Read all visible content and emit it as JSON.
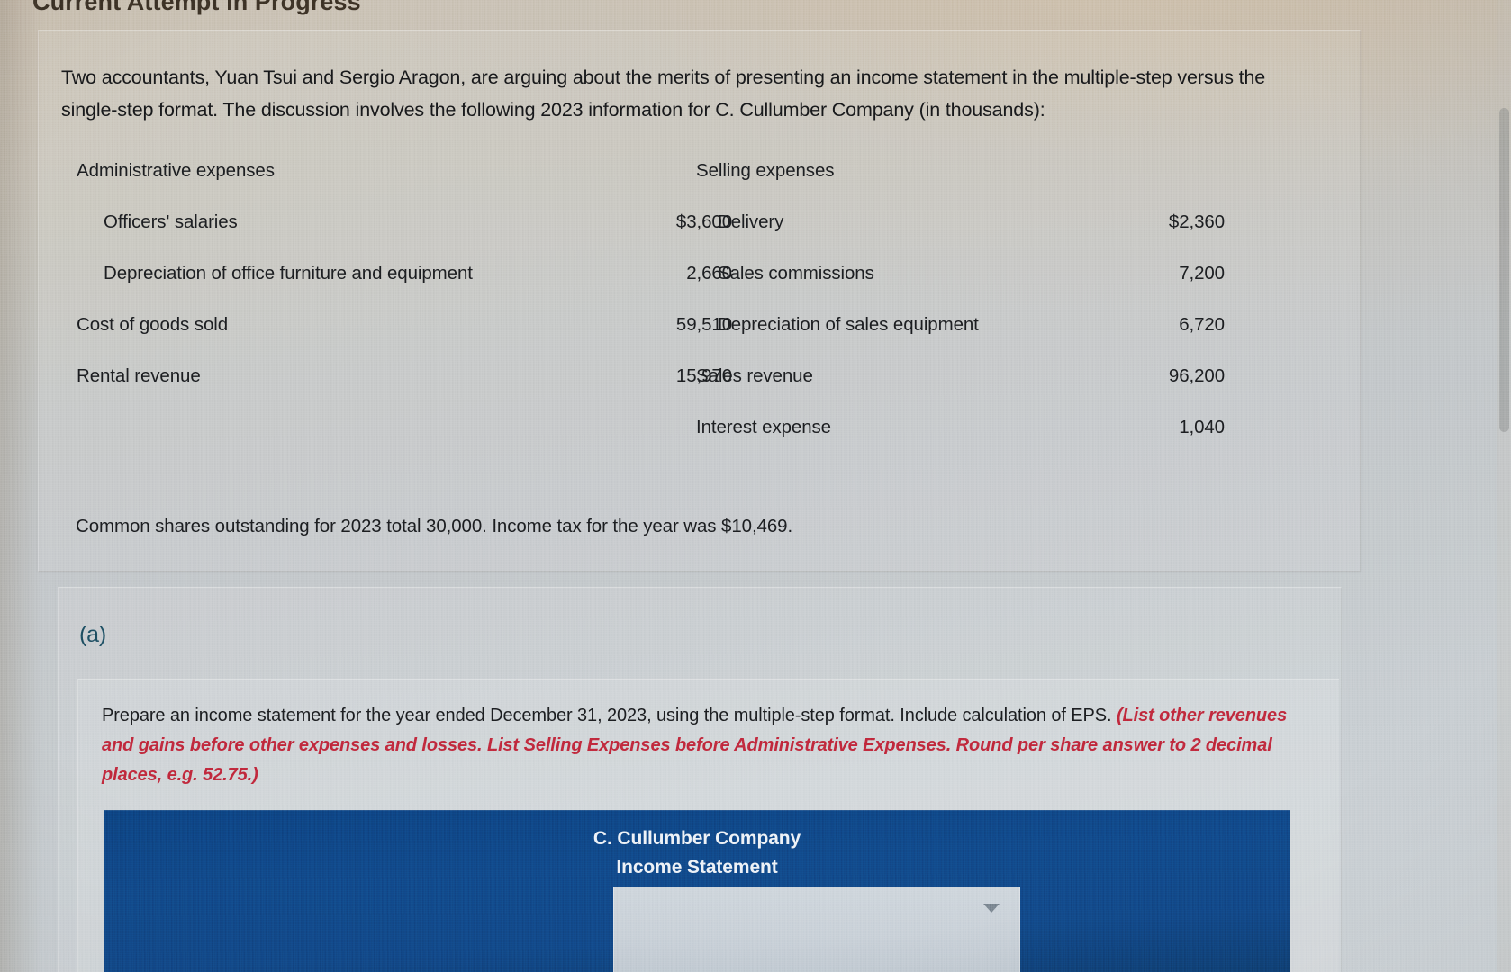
{
  "banner": {
    "attempt_status": "Current Attempt in Progress"
  },
  "question": {
    "prompt": "Two accountants, Yuan Tsui and Sergio Aragon, are arguing about the merits of presenting an income statement in the multiple-step versus the single-step format. The discussion involves the following 2023 information for C. Cullumber Company (in thousands):",
    "shares_note": "Common shares outstanding for 2023 total 30,000. Income tax for the year was $10,469."
  },
  "table": {
    "left_header": "Administrative expenses",
    "right_header": "Selling expenses",
    "rows": [
      {
        "left_label": "Officers' salaries",
        "left_indent": true,
        "left_value": "$3,600",
        "right_label": "Delivery",
        "right_indent": true,
        "right_value": "$2,360"
      },
      {
        "left_label": "Depreciation of office furniture and equipment",
        "left_indent": true,
        "left_value": "2,660",
        "right_label": "Sales commissions",
        "right_indent": true,
        "right_value": "7,200"
      },
      {
        "left_label": "Cost of goods sold",
        "left_indent": false,
        "left_value": "59,510",
        "right_label": "Depreciation of sales equipment",
        "right_indent": true,
        "right_value": "6,720"
      },
      {
        "left_label": "Rental revenue",
        "left_indent": false,
        "left_value": "15,970",
        "right_label": "Sales revenue",
        "right_indent": false,
        "right_value": "96,200"
      },
      {
        "left_label": "",
        "left_indent": false,
        "left_value": "",
        "right_label": "Interest expense",
        "right_indent": false,
        "right_value": "1,040"
      }
    ]
  },
  "part_a": {
    "label": "(a)",
    "instruction_main": "Prepare an income statement for the year ended December 31, 2023, using the multiple-step format. Include calculation of EPS.",
    "instruction_hint": "(List other revenues and gains before other expenses and losses. List Selling Expenses before Administrative Expenses. Round per share answer to 2 decimal places, e.g. 52.75.)"
  },
  "statement": {
    "company_name": "C. Cullumber Company",
    "statement_title": "Income Statement",
    "period_select_value": "",
    "header_color": "#114a8c",
    "caret_icon": "chevron-down-icon"
  },
  "colors": {
    "hint_red": "#c0283c",
    "part_label_teal": "#1d4f63",
    "statement_blue": "#114a8c"
  }
}
